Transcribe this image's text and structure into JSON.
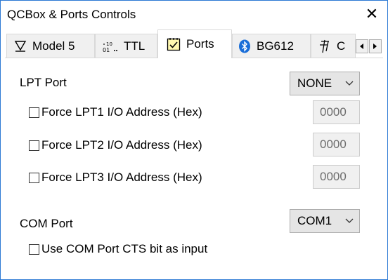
{
  "window": {
    "title": "QCBox & Ports Controls",
    "close_glyph": "✕"
  },
  "tabs": [
    {
      "label": "Model 5",
      "icon": "model5-icon",
      "active": false
    },
    {
      "label": "TTL",
      "icon": "ttl-icon",
      "active": false
    },
    {
      "label": "Ports",
      "icon": "ports-icon",
      "active": true
    },
    {
      "label": "BG612",
      "icon": "bluetooth-icon",
      "active": false
    },
    {
      "label": "C",
      "icon": "c-icon",
      "active": false
    }
  ],
  "lpt": {
    "label": "LPT Port",
    "selected": "NONE",
    "force": [
      {
        "label": "Force LPT1 I/O Address (Hex)",
        "checked": false,
        "value": "0000"
      },
      {
        "label": "Force LPT2 I/O Address (Hex)",
        "checked": false,
        "value": "0000"
      },
      {
        "label": "Force LPT3 I/O Address (Hex)",
        "checked": false,
        "value": "0000"
      }
    ]
  },
  "com": {
    "label": "COM Port",
    "selected": "COM1",
    "cts_label": "Use COM Port CTS bit as input",
    "cts_checked": false
  },
  "colors": {
    "window_border": "#2b79d4",
    "bluetooth": "#1a6ed8",
    "ports_icon_fill": "#fff8b0"
  }
}
